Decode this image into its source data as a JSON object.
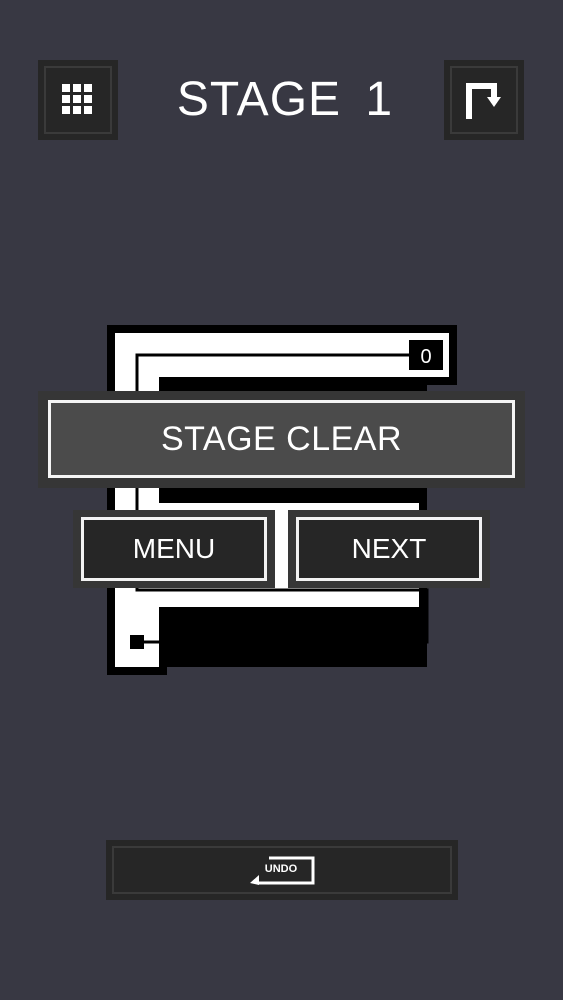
{
  "header": {
    "stage_label": "STAGE",
    "stage_number": "1",
    "left_icon": "grid-icon",
    "right_icon": "restart-icon"
  },
  "board": {
    "move_count": "0"
  },
  "overlay": {
    "stage_clear_label": "STAGE CLEAR",
    "menu_label": "MENU",
    "next_label": "NEXT"
  },
  "footer": {
    "undo_label": "UNDO"
  },
  "colors": {
    "background": "#383843",
    "panel": "#262626",
    "board_white": "#ffffff",
    "path": "#000000"
  }
}
